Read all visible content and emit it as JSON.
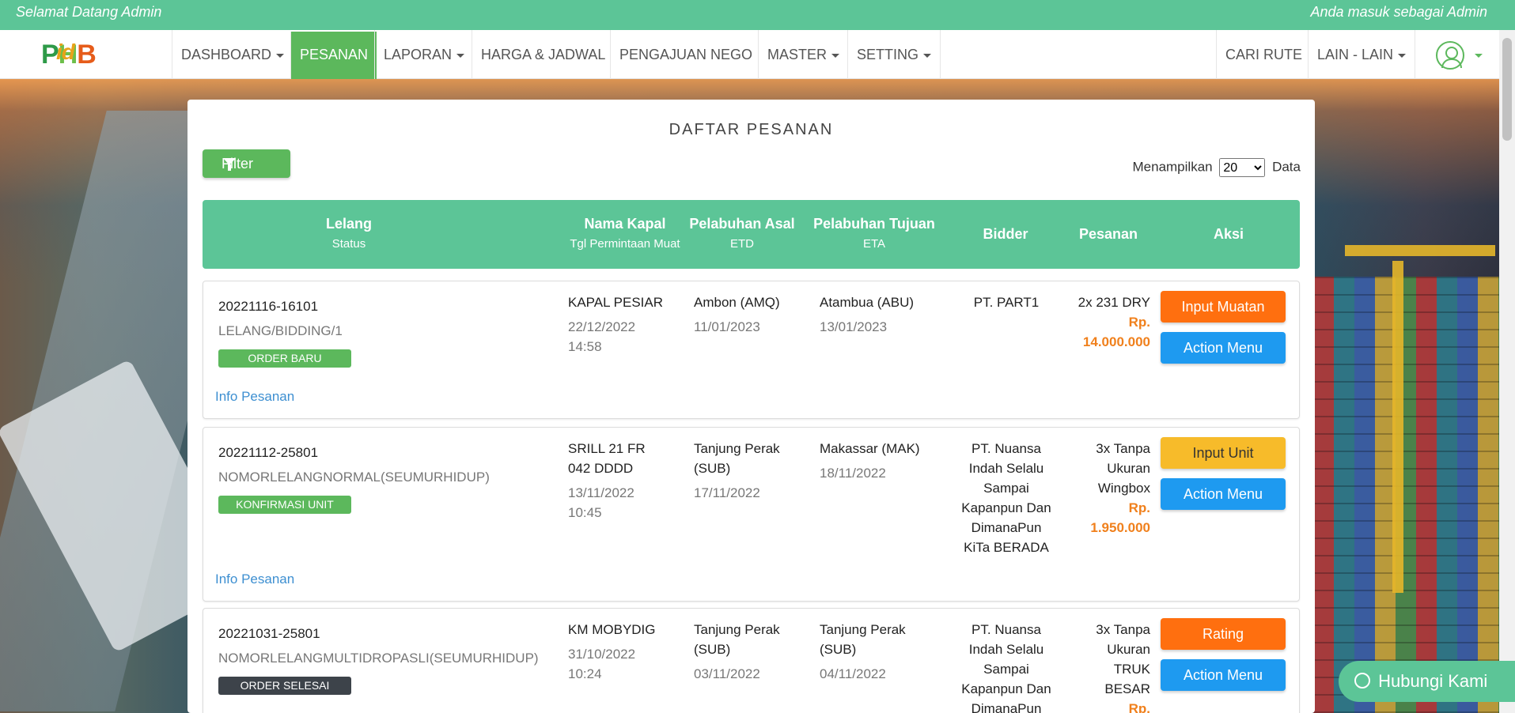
{
  "topbar": {
    "welcome": "Selamat Datang Admin",
    "logged_in": "Anda masuk sebagai Admin"
  },
  "logo": {
    "p": "P",
    "h": "H",
    "b": "B",
    "id": "id"
  },
  "nav": {
    "dashboard": "DASHBOARD",
    "pesanan": "PESANAN",
    "laporan": "LAPORAN",
    "harga_jadwal": "HARGA & JADWAL",
    "pengajuan_nego": "PENGAJUAN NEGO",
    "master": "MASTER",
    "setting": "SETTING",
    "cari_rute": "CARI RUTE",
    "lain_lain": "LAIN - LAIN"
  },
  "colors": {
    "brand_green": "#5cc597",
    "button_green": "#5cb85c",
    "orange": "#ff6f0f",
    "yellow": "#f7bb2a",
    "blue": "#1e9af0",
    "price": "#f0801c"
  },
  "icons": [
    "filter-icon",
    "user-avatar-icon",
    "whatsapp-icon",
    "caret-down-icon"
  ],
  "page": {
    "title": "DAFTAR PESANAN",
    "filter_label": "Filter",
    "show_prefix": "Menampilkan",
    "show_value": "20",
    "show_suffix": "Data"
  },
  "table": {
    "headers": {
      "lelang": "Lelang",
      "status": "Status",
      "nama_kapal": "Nama Kapal",
      "tgl_muat": "Tgl Permintaan Muat",
      "asal": "Pelabuhan Asal",
      "etd": "ETD",
      "tujuan": "Pelabuhan Tujuan",
      "eta": "ETA",
      "bidder": "Bidder",
      "pesanan": "Pesanan",
      "aksi": "Aksi"
    },
    "rows": [
      {
        "id": "20221116-16101",
        "lelang": "LELANG/BIDDING/1",
        "status": "ORDER BARU",
        "kapal": "KAPAL PESIAR",
        "tgl": "22/12/2022",
        "jam": "14:58",
        "asal": "Ambon (AMQ)",
        "etd": "11/01/2023",
        "tujuan": "Atambua (ABU)",
        "eta": "13/01/2023",
        "bidder": "PT. PART1",
        "pesanan": "2x 231 DRY",
        "price_prefix": "Rp.",
        "price": "14.000.000",
        "action1": "Input Muatan",
        "action2": "Action Menu",
        "info": "Info Pesanan"
      },
      {
        "id": "20221112-25801",
        "lelang": "NOMORLELANGNORMAL(SEUMURHIDUP)",
        "status": "KONFIRMASI UNIT",
        "kapal_1": "SRILL 21 FR",
        "kapal_2": "042 DDDD",
        "tgl": "13/11/2022",
        "jam": "10:45",
        "asal_1": "Tanjung Perak",
        "asal_2": "(SUB)",
        "etd": "17/11/2022",
        "tujuan": "Makassar (MAK)",
        "eta": "18/11/2022",
        "bidder": [
          "PT. Nuansa",
          "Indah Selalu",
          "Sampai",
          "Kapanpun Dan",
          "DimanaPun",
          "KiTa BERADA"
        ],
        "pesanan": [
          "3x Tanpa",
          "Ukuran",
          "Wingbox"
        ],
        "price_prefix": "Rp.",
        "price": "1.950.000",
        "action1": "Input Unit",
        "action2": "Action Menu",
        "info": "Info Pesanan"
      },
      {
        "id": "20221031-25801",
        "lelang": "NOMORLELANGMULTIDROPASLI(SEUMURHIDUP)",
        "status": "ORDER SELESAI",
        "kapal": "KM MOBYDIG",
        "tgl": "31/10/2022",
        "jam": "10:24",
        "asal_1": "Tanjung Perak",
        "asal_2": "(SUB)",
        "etd": "03/11/2022",
        "tujuan_1": "Tanjung Perak",
        "tujuan_2": "(SUB)",
        "eta": "04/11/2022",
        "bidder": [
          "PT. Nuansa",
          "Indah Selalu",
          "Sampai",
          "Kapanpun Dan",
          "DimanaPun"
        ],
        "pesanan": [
          "3x Tanpa",
          "Ukuran",
          "TRUK",
          "BESAR"
        ],
        "price_prefix": "Rp.",
        "action1": "Rating",
        "action2": "Action Menu"
      }
    ]
  },
  "whatsapp": {
    "label": "Hubungi Kami"
  }
}
